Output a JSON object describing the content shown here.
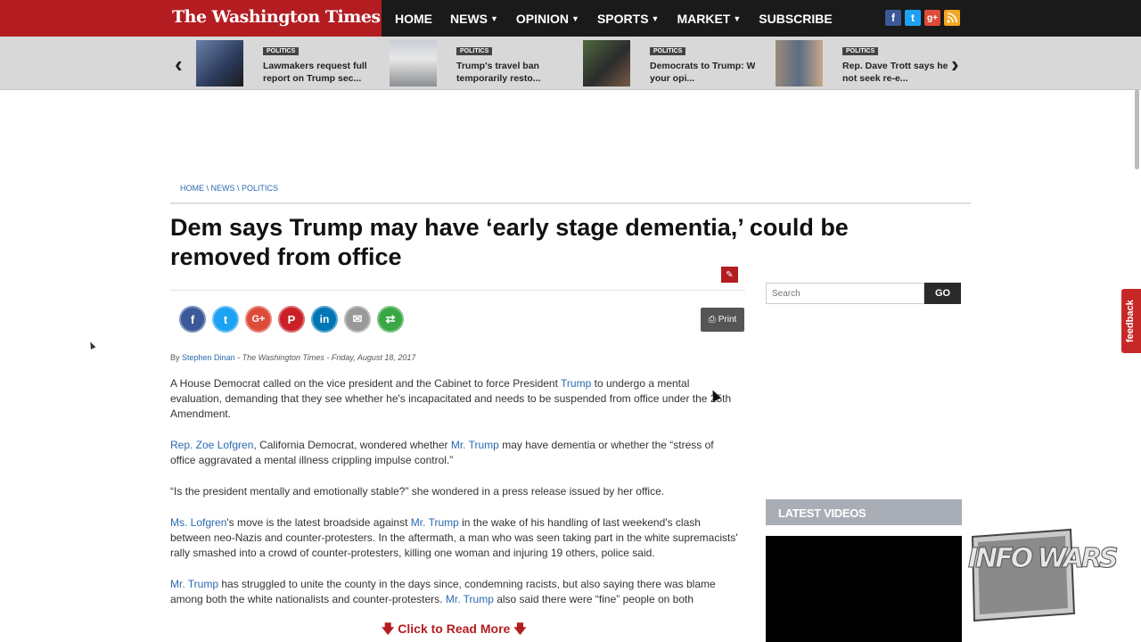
{
  "brand": {
    "logo": "The Washington Times"
  },
  "nav": {
    "items": [
      {
        "label": "HOME",
        "caret": false
      },
      {
        "label": "NEWS",
        "caret": true
      },
      {
        "label": "OPINION",
        "caret": true
      },
      {
        "label": "SPORTS",
        "caret": true
      },
      {
        "label": "MARKET",
        "caret": true
      },
      {
        "label": "SUBSCRIBE",
        "caret": false
      }
    ],
    "social": [
      "facebook-icon",
      "twitter-icon",
      "google-plus-icon",
      "rss-icon"
    ]
  },
  "carousel": {
    "items": [
      {
        "tag": "POLITICS",
        "title_line1": "Lawmakers request full",
        "title_line2": "report on Trump sec..."
      },
      {
        "tag": "POLITICS",
        "title_line1": "Trump's travel ban",
        "title_line2": "temporarily resto..."
      },
      {
        "tag": "POLITICS",
        "title_line1": "Democrats to Trump: Where's",
        "title_line2": "your opi..."
      },
      {
        "tag": "POLITICS",
        "title_line1": "Rep. Dave Trott says he w",
        "title_line2": "not seek re-e..."
      }
    ]
  },
  "breadcrumb": "HOME \\ NEWS \\ POLITICS",
  "article": {
    "headline": "Dem says Trump may have ‘early stage dementia,’ could be removed from office",
    "print_label": "Print",
    "byline": {
      "by": "By",
      "author": "Stephen Dinan",
      "rest": " - The Washington Times - Friday, August 18, 2017"
    },
    "p1": {
      "a": "A House Democrat called on the vice president and the Cabinet to force President ",
      "link": "Trump",
      "b": " to undergo a mental evaluation, demanding that they see whether he's incapacitated and needs to be suspended from office under the 25th Amendment."
    },
    "p2": {
      "link1": "Rep. Zoe Lofgren",
      "a": ", California Democrat, wondered whether ",
      "link2": "Mr. Trump",
      "b": " may have dementia or whether the “stress of office aggravated a mental illness crippling impulse control.”"
    },
    "p3": "“Is the president mentally and emotionally stable?” she wondered in a press release issued by her office.",
    "p4": {
      "link1": "Ms. Lofgren",
      "a": "'s move is the latest broadside against ",
      "link2": "Mr. Trump",
      "b": " in the wake of his handling of last weekend's clash between neo-Nazis and counter-protesters. In the aftermath, a man who was seen taking part in the white supremacists' rally smashed into a crowd of counter-protesters, killing one woman and injuring 19 others, police said."
    },
    "p5": {
      "link1": "Mr. Trump",
      "a": " has struggled to unite the county in the days since, condemning racists, but also saying there was blame among both the white nationalists and counter-protesters. ",
      "link2": "Mr. Trump",
      "b": " also said there were “fine” people on both"
    },
    "read_more": "Click to Read More"
  },
  "sidebar": {
    "search_placeholder": "Search",
    "go_label": "GO",
    "latest_videos": "LATEST VIDEOS"
  },
  "feedback": "feedback",
  "watermark": "INFO WARS"
}
